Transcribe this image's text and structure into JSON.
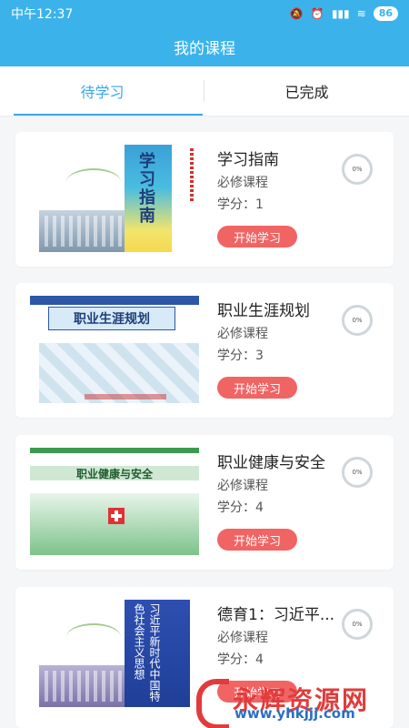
{
  "status_bar": {
    "time": "中午12:37",
    "battery": "86"
  },
  "header": {
    "title": "我的课程"
  },
  "tabs": [
    {
      "label": "待学习",
      "active": true
    },
    {
      "label": "已完成",
      "active": false
    }
  ],
  "courses": [
    {
      "title": "学习指南",
      "category": "必修课程",
      "credit": "学分：1",
      "progress": "0%",
      "action": "开始学习",
      "cover_title": "学习指南"
    },
    {
      "title": "职业生涯规划",
      "category": "必修课程",
      "credit": "学分：3",
      "progress": "0%",
      "action": "开始学习",
      "cover_title": "职业生涯规划"
    },
    {
      "title": "职业健康与安全",
      "category": "必修课程",
      "credit": "学分：4",
      "progress": "0%",
      "action": "开始学习",
      "cover_title": "职业健康与安全"
    },
    {
      "title": "德育1：习近平...",
      "category": "必修课程",
      "credit": "学分：4",
      "progress": "0%",
      "action": "开始学习",
      "cover_title": "习近平新时代中国特色社会主义思想"
    }
  ],
  "watermark": {
    "name": "永辉资源网",
    "url": "www.yhkjjj.com"
  },
  "colors": {
    "primary": "#3bb3ea",
    "tab_active": "#3aa8e6",
    "button": "#f06464"
  }
}
